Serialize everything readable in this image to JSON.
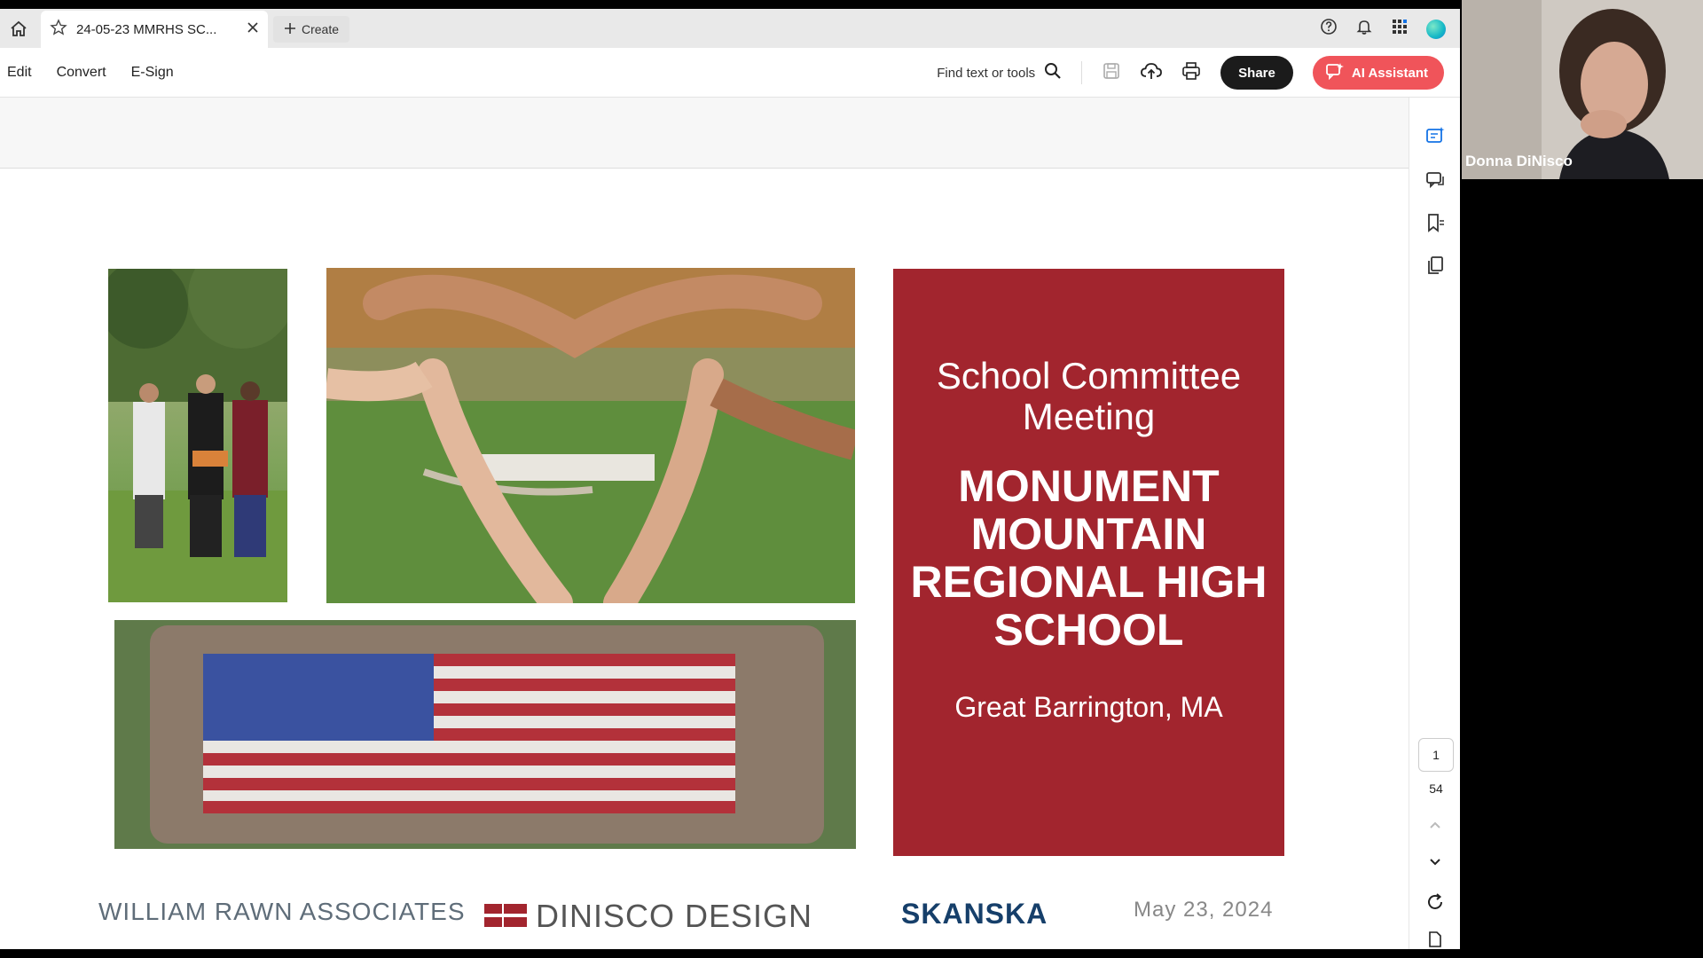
{
  "tabbar": {
    "doc_tab_title": "24-05-23 MMRHS SC...",
    "create_label": "Create"
  },
  "toolbar": {
    "menu": [
      "Edit",
      "Convert",
      "E-Sign"
    ],
    "find_label": "Find text or tools",
    "share_label": "Share",
    "ai_label": "AI Assistant"
  },
  "pager": {
    "current": "1",
    "total": "54"
  },
  "slide": {
    "subtitle": "School Committee Meeting",
    "school_name": "MONUMENT MOUNTAIN REGIONAL HIGH SCHOOL",
    "location": "Great Barrington, MA",
    "logos": {
      "rawn": "WILLIAM RAWN ASSOCIATES",
      "dinisco": "DINISCO DESIGN",
      "skanska": "SKANSKA"
    },
    "date": "May 23, 2024"
  },
  "video": {
    "participant_name": "Donna DiNisco"
  },
  "colors": {
    "card": "#a2252e",
    "ai_button": "#f0545a",
    "share_button": "#1b1b1b",
    "skanska": "#163f6a"
  }
}
